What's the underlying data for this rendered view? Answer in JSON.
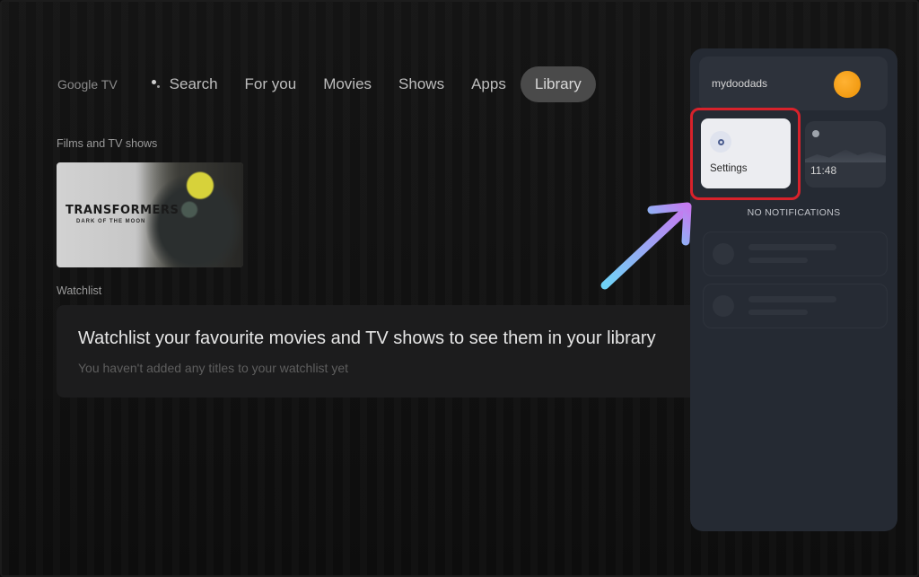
{
  "topnav": {
    "brand": "Google TV",
    "items": [
      {
        "label": "Search"
      },
      {
        "label": "For you"
      },
      {
        "label": "Movies"
      },
      {
        "label": "Shows"
      },
      {
        "label": "Apps"
      },
      {
        "label": "Library",
        "active": true
      }
    ]
  },
  "library": {
    "films_label": "Films and TV shows",
    "poster": {
      "title": "TRANSFORMERS",
      "subtitle": "DARK OF THE MOON"
    },
    "watchlist_label": "Watchlist",
    "watchlist_card": {
      "headline": "Watchlist your favourite movies and TV shows to see them in your library",
      "sub": "You haven't added any titles to your watchlist yet"
    }
  },
  "panel": {
    "profile_name": "mydoodads",
    "settings_label": "Settings",
    "clock_time": "11:48",
    "notifications_label": "NO NOTIFICATIONS"
  },
  "colors": {
    "highlight": "#d8222b",
    "arrow_start": "#6fd3f7",
    "arrow_end": "#c57af0",
    "avatar": "#f29b12"
  },
  "icons": [
    "mic-dot-icon",
    "settings-gear-icon",
    "avatar-icon",
    "pointer-arrow-icon"
  ]
}
